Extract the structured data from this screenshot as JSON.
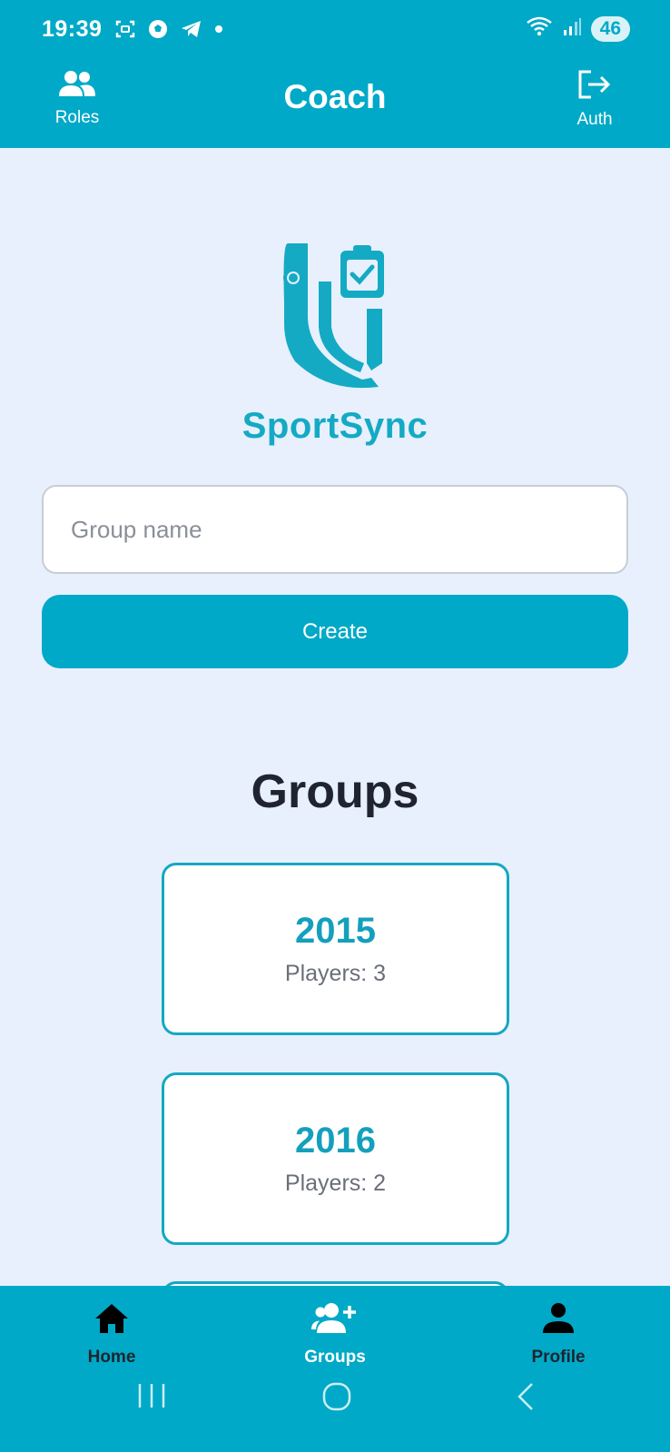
{
  "status_bar": {
    "time": "19:39",
    "battery": "46",
    "icons_left": [
      "screenshot-icon",
      "soccer-ball-icon",
      "telegram-icon",
      "notification-dot-icon"
    ],
    "icons_right": [
      "wifi-icon",
      "signal-icon"
    ]
  },
  "app_bar": {
    "title": "Coach",
    "left_action": {
      "label": "Roles",
      "icon": "people-icon"
    },
    "right_action": {
      "label": "Auth",
      "icon": "logout-icon"
    }
  },
  "logo": {
    "text": "SportSync",
    "icon": "sportsync-shield-clipboard-icon"
  },
  "form": {
    "group_name_placeholder": "Group name",
    "group_name_value": "",
    "create_label": "Create"
  },
  "groups_section": {
    "title": "Groups",
    "groups": [
      {
        "name": "2015",
        "players": "Players: 3"
      },
      {
        "name": "2016",
        "players": "Players: 2"
      }
    ]
  },
  "bottom_nav": {
    "items": [
      {
        "label": "Home",
        "icon": "home-icon"
      },
      {
        "label": "Groups",
        "icon": "add-group-icon"
      },
      {
        "label": "Profile",
        "icon": "person-icon"
      }
    ]
  },
  "system_nav": [
    "recents-icon",
    "home-circle-icon",
    "back-icon"
  ],
  "colors": {
    "primary": "#00a9c7",
    "background": "#e8f0fd",
    "card_border": "#14a8c2",
    "card_title": "#14a0bc"
  }
}
